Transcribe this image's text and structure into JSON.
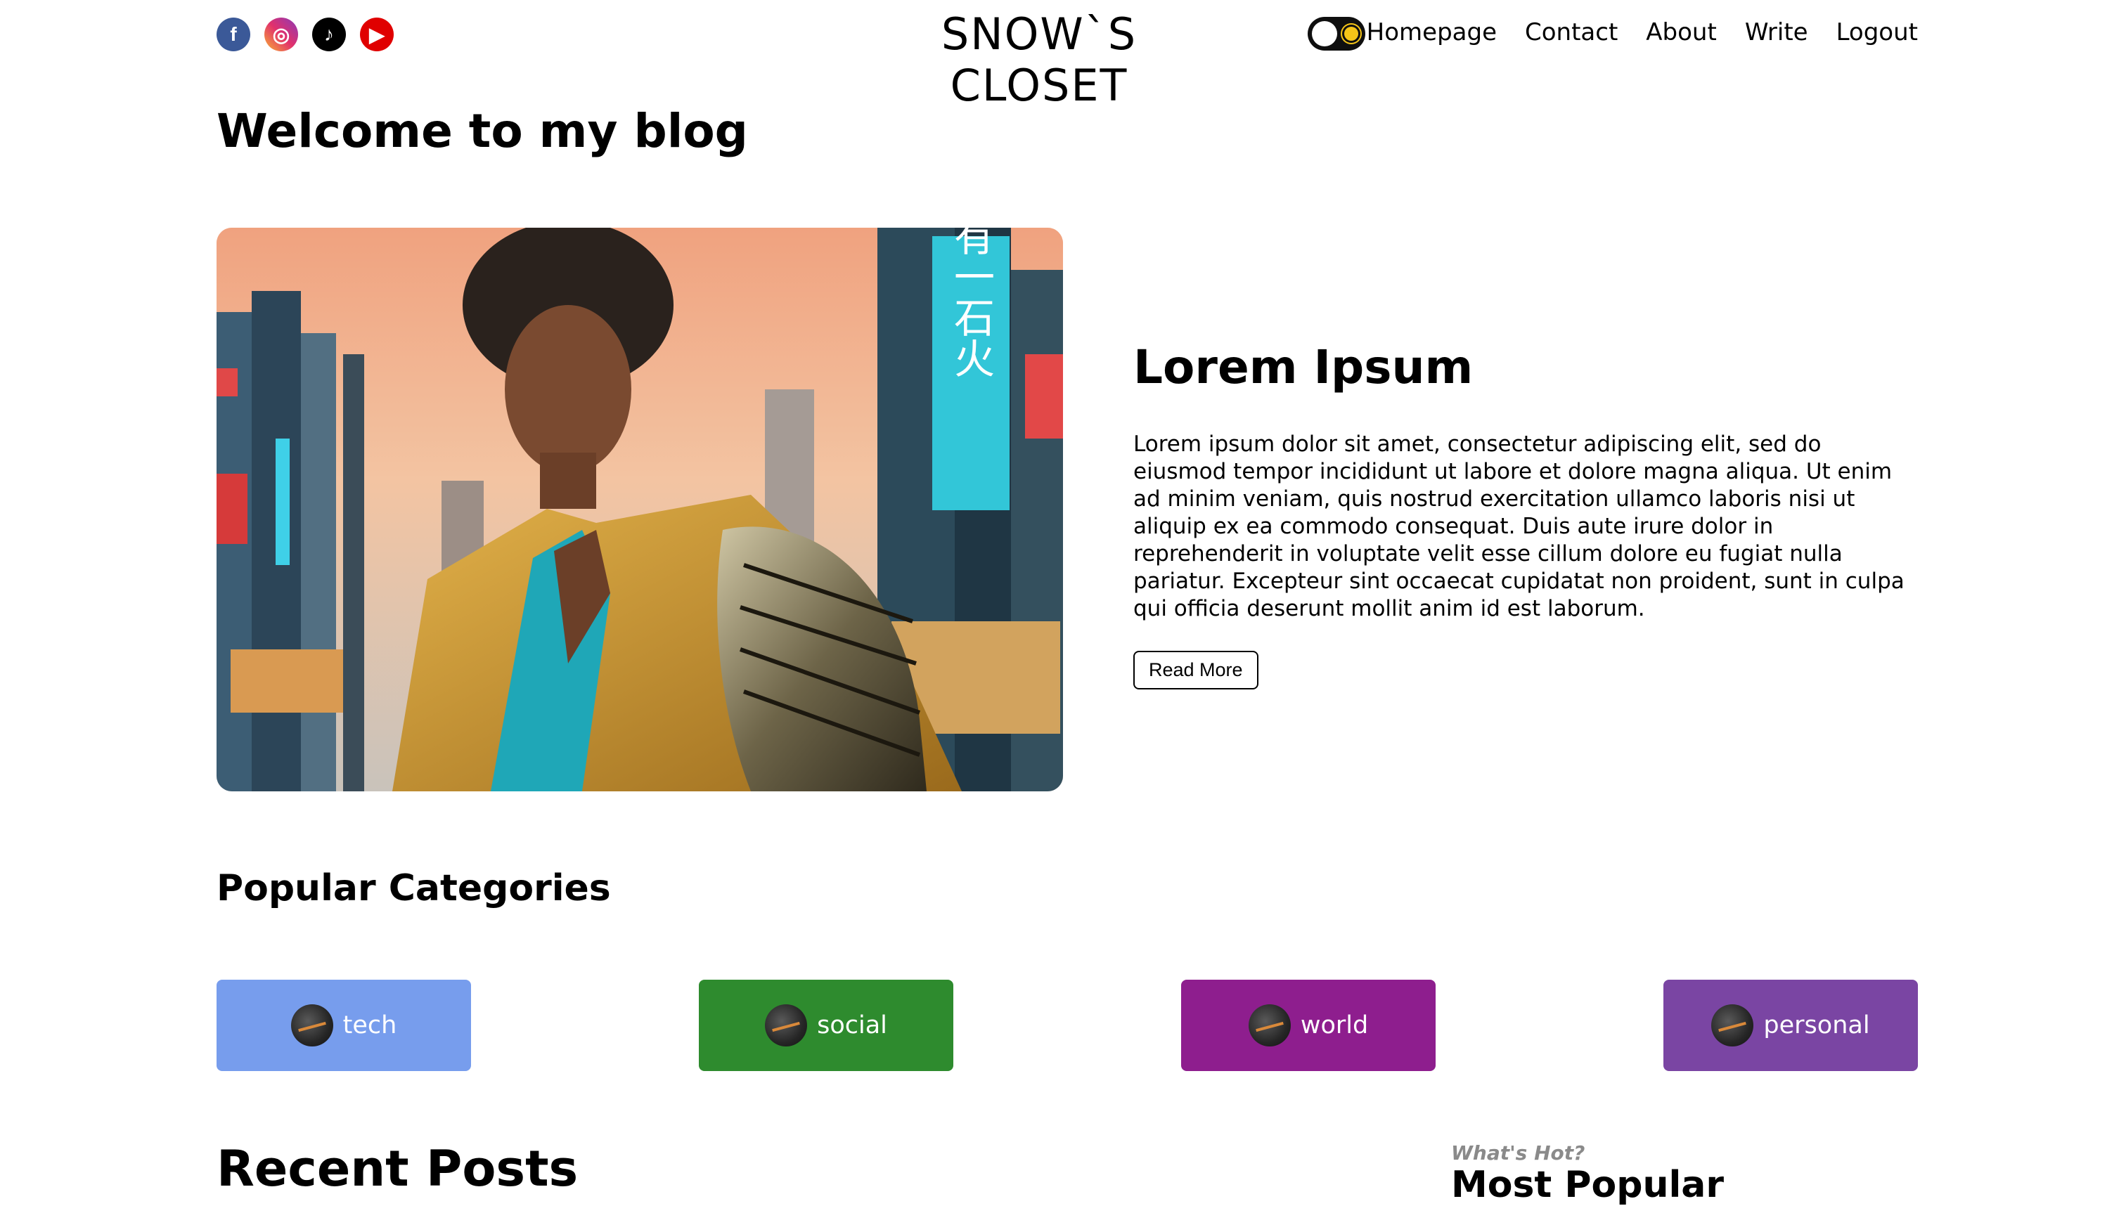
{
  "navbar": {
    "socials": [
      {
        "name": "facebook-icon",
        "glyph": "f"
      },
      {
        "name": "instagram-icon",
        "glyph": "◎"
      },
      {
        "name": "tiktok-icon",
        "glyph": "♪"
      },
      {
        "name": "youtube-icon",
        "glyph": "▶"
      }
    ],
    "logo": "SNOW`S CLOSET",
    "links": [
      "Homepage",
      "Contact",
      "About",
      "Write",
      "Logout"
    ]
  },
  "welcome_title": "Welcome to my blog",
  "featured": {
    "title": "Lorem Ipsum",
    "description": "Lorem ipsum dolor sit amet, consectetur adipiscing elit, sed do eiusmod tempor incididunt ut labore et dolore magna aliqua. Ut enim ad minim veniam, quis nostrud exercitation ullamco laboris nisi ut aliquip ex ea commodo consequat. Duis aute irure dolor in reprehenderit in voluptate velit esse cillum dolore eu fugiat nulla pariatur. Excepteur sint occaecat cupidatat non proident, sunt in culpa qui officia deserunt mollit anim id est laborum.",
    "button": "Read More",
    "sign_text": "左文有一石火"
  },
  "categories": {
    "heading": "Popular Categories",
    "items": [
      {
        "label": "tech",
        "color": "#779ded"
      },
      {
        "label": "social",
        "color": "#2e8b2e"
      },
      {
        "label": "world",
        "color": "#8e1e8e"
      },
      {
        "label": "personal",
        "color": "#7a45a3"
      }
    ]
  },
  "recent": {
    "heading": "Recent Posts"
  },
  "popular": {
    "subtitle": "What's Hot?",
    "title": "Most Popular"
  }
}
